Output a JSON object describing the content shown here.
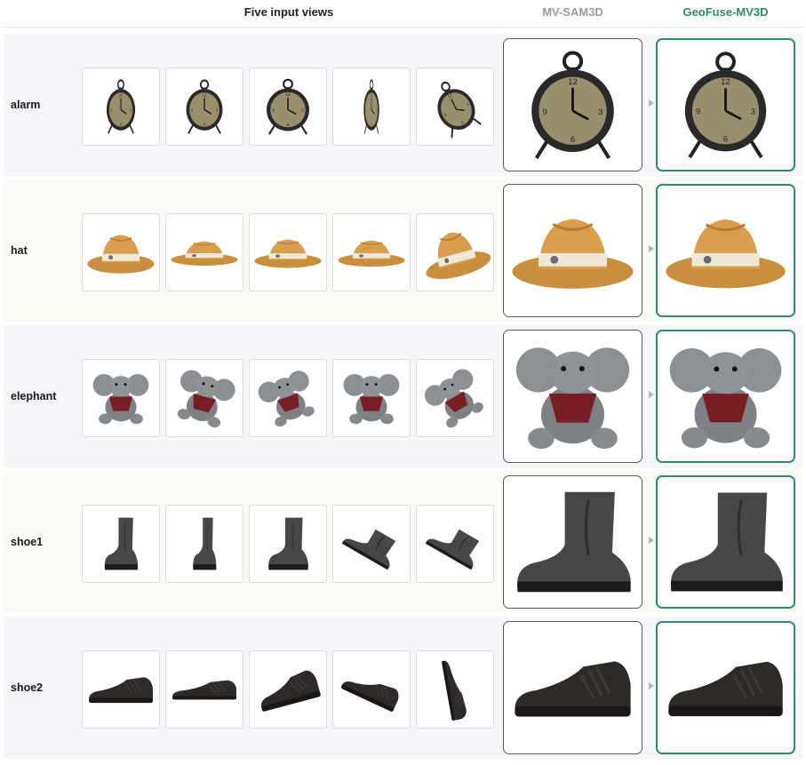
{
  "header": {
    "views_label": "Five input views",
    "baseline_label": "MV-SAM3D",
    "ours_label": "GeoFuse-MV3D",
    "ours_color": "#2e8b6a"
  },
  "rows": [
    {
      "label": "alarm"
    },
    {
      "label": "hat"
    },
    {
      "label": "elephant"
    },
    {
      "label": "shoe1"
    },
    {
      "label": "shoe2"
    }
  ]
}
